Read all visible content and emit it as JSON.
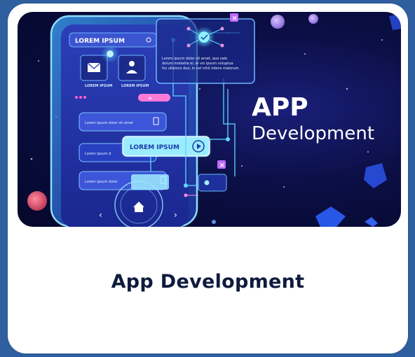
{
  "card": {
    "title": "App Development",
    "image": {
      "headline_line1": "APP",
      "headline_line2": "Development",
      "phone_header": "LOREM IPSUM",
      "icon_label_1": "LOREM IPSUM",
      "icon_label_2": "LOREM IPSUM",
      "row_1_text": "Lorem ipsum dolor sit amet",
      "row_2_text": "Lorem ipsum d",
      "row_3_text": "Lorem ipsum dolor",
      "popup_title": "LOREM IPSUM",
      "info_text_1": "Lorem ipsum dolor sit amet, quo sale",
      "info_text_2": "dolum molestie ei, ei vix ipsum voluptua",
      "info_text_3": "his ullamco duo, in vel nihil ridens malorum."
    }
  },
  "colors": {
    "page_bg": "#2f5f9e",
    "card_bg": "#ffffff",
    "title_color": "#0f1b3d",
    "neon_cyan": "#5fd8ff",
    "neon_pink": "#ff5fd1"
  }
}
